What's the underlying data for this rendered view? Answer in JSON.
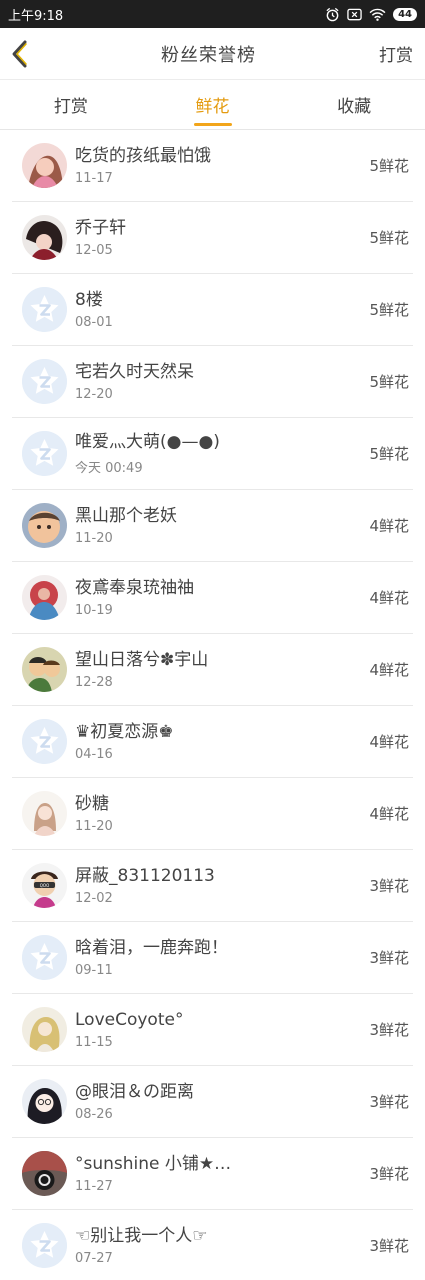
{
  "status_bar": {
    "time": "上午9:18",
    "battery": "44"
  },
  "header": {
    "title": "粉丝荣誉榜",
    "action": "打赏"
  },
  "tabs": [
    {
      "label": "打赏"
    },
    {
      "label": "鲜花"
    },
    {
      "label": "收藏"
    }
  ],
  "colors": {
    "accent": "#f2a51a",
    "default_avatar_bg": "#e4edf8"
  },
  "list": [
    {
      "name": "吃货的孩纸最怕饿",
      "date": "11-17",
      "count": "5鲜花",
      "avatar": "photo-pink"
    },
    {
      "name": "乔子轩",
      "date": "12-05",
      "count": "5鲜花",
      "avatar": "photo-dark"
    },
    {
      "name": "8楼",
      "date": "08-01",
      "count": "5鲜花",
      "avatar": "default"
    },
    {
      "name": "宅若久时天然呆",
      "date": "12-20",
      "count": "5鲜花",
      "avatar": "default"
    },
    {
      "name": "唯爱灬大萌(●—●)",
      "date": "今天 00:49",
      "count": "5鲜花",
      "avatar": "default"
    },
    {
      "name": "黑山那个老妖",
      "date": "11-20",
      "count": "4鲜花",
      "avatar": "photo-baby"
    },
    {
      "name": "夜鳶奉泉珫䄂䄂",
      "date": "10-19",
      "count": "4鲜花",
      "avatar": "photo-red"
    },
    {
      "name": "望山日落兮✽宇山",
      "date": "12-28",
      "count": "4鲜花",
      "avatar": "photo-cartoon"
    },
    {
      "name": "♛初夏恋源♚",
      "date": "04-16",
      "count": "4鲜花",
      "avatar": "default"
    },
    {
      "name": "砂糖",
      "date": "11-20",
      "count": "4鲜花",
      "avatar": "photo-light"
    },
    {
      "name": "屏蔽_831120113",
      "date": "12-02",
      "count": "3鲜花",
      "avatar": "photo-kid"
    },
    {
      "name": "晗着泪，一鹿奔跑！",
      "date": "09-11",
      "count": "3鲜花",
      "avatar": "default"
    },
    {
      "name": "LoveCoyote°",
      "date": "11-15",
      "count": "3鲜花",
      "avatar": "photo-blond"
    },
    {
      "name": "@眼泪＆の距离",
      "date": "08-26",
      "count": "3鲜花",
      "avatar": "photo-anime"
    },
    {
      "name": "°sunshine 小铺★…",
      "date": "11-27",
      "count": "3鲜花",
      "avatar": "photo-ring"
    },
    {
      "name": "☜别让我一个人☞",
      "date": "07-27",
      "count": "3鲜花",
      "avatar": "default"
    }
  ]
}
